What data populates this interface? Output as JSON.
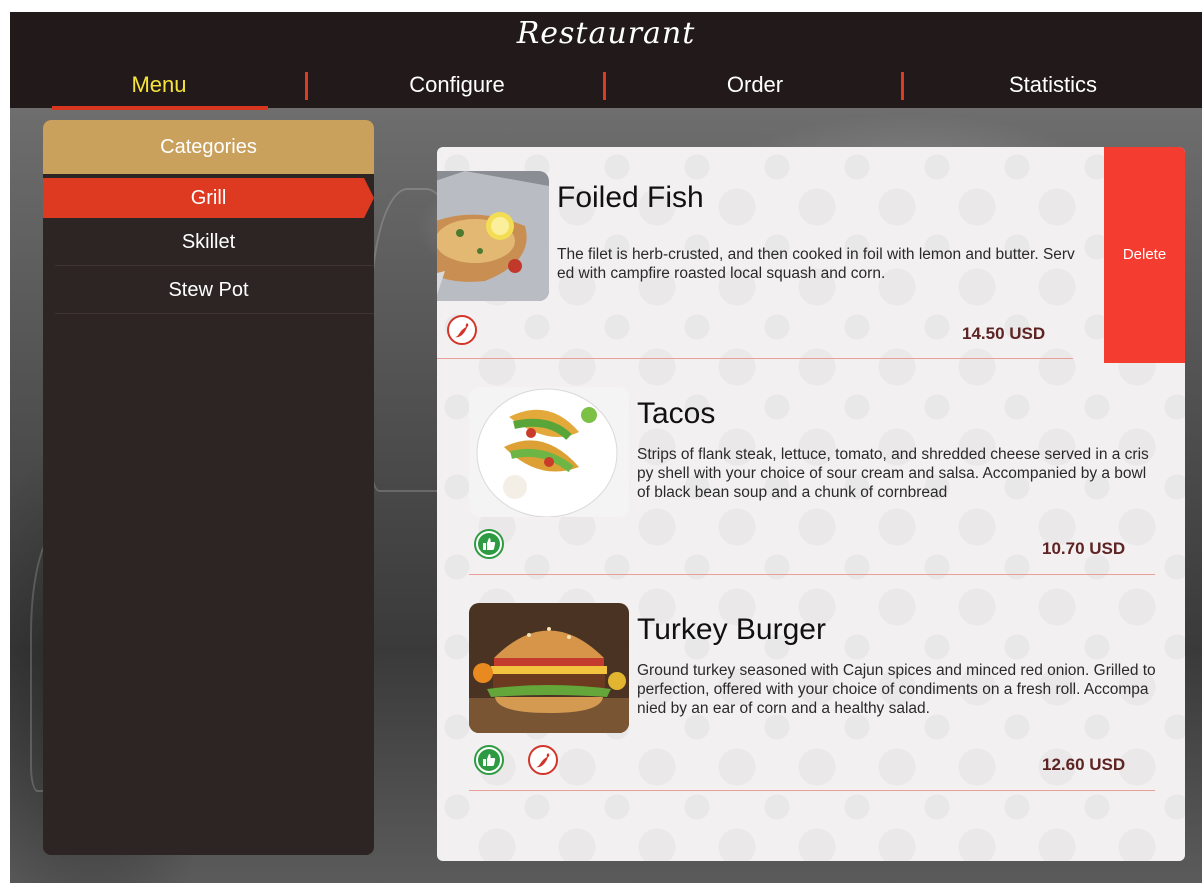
{
  "app": {
    "title": "Restaurant"
  },
  "nav": {
    "tabs": [
      {
        "label": "Menu"
      },
      {
        "label": "Configure"
      },
      {
        "label": "Order"
      },
      {
        "label": "Statistics"
      }
    ],
    "active_index": 0
  },
  "sidebar": {
    "header": "Categories",
    "items": [
      {
        "label": "Grill"
      },
      {
        "label": "Skillet"
      },
      {
        "label": "Stew Pot"
      }
    ],
    "active_index": 0
  },
  "menu_items": [
    {
      "name": "Foiled Fish",
      "description": "The filet is herb-crusted, and then cooked in foil with lemon and butter. Served with campfire roasted local squash and corn.",
      "price": "14.50 USD",
      "badges": [
        "chili-icon"
      ],
      "image": "foiled-fish-photo"
    },
    {
      "name": "Tacos",
      "description": "Strips of flank steak, lettuce, tomato, and shredded cheese served in a crispy shell with your choice of sour cream and salsa. Accompanied by a bowl of black bean soup and a chunk of cornbread",
      "price": "10.70 USD",
      "badges": [
        "thumbs-up-icon"
      ],
      "image": "tacos-photo"
    },
    {
      "name": "Turkey Burger",
      "description": "Ground turkey seasoned with Cajun spices and minced red onion. Grilled to perfection, offered with your choice of condiments on a fresh roll. Accompanied by an ear of corn and a healthy salad.",
      "price": "12.60 USD",
      "badges": [
        "thumbs-up-icon",
        "chili-icon"
      ],
      "image": "turkey-burger-photo"
    }
  ],
  "swipe_action": {
    "label": "Delete"
  },
  "colors": {
    "header_bg": "#221a1a",
    "active_tab": "#f5e33a",
    "accent_red": "#de3a22",
    "category_header": "#c9a05c",
    "sidebar_bg": "#2d2424",
    "delete_bg": "#f43c31",
    "price": "#5e2323",
    "vegan_green": "#2e9b43"
  }
}
